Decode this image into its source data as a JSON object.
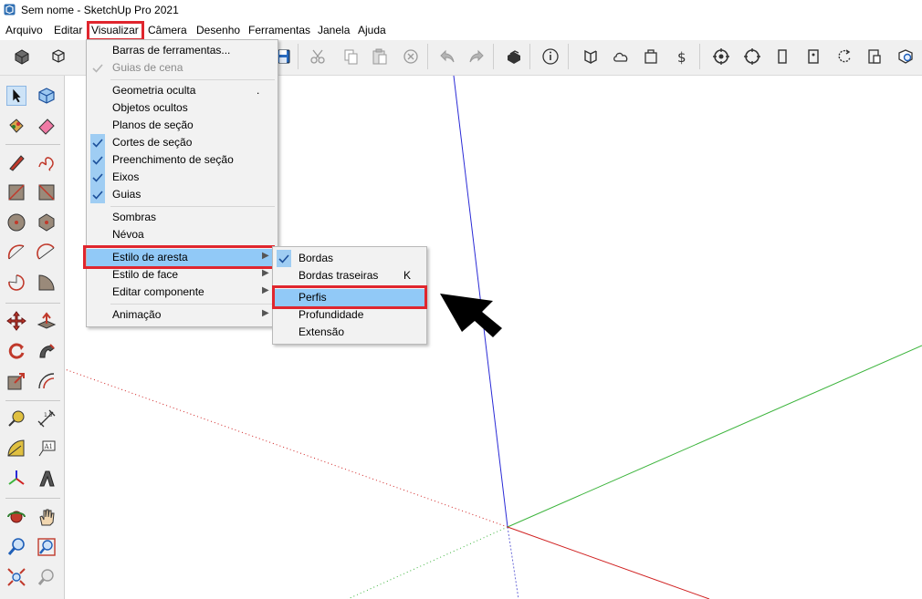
{
  "window": {
    "title": "Sem nome - SketchUp Pro 2021"
  },
  "menubar": {
    "items": [
      "Arquivo",
      "Editar",
      "Visualizar",
      "Câmera",
      "Desenho",
      "Ferramentas",
      "Janela",
      "Ajuda"
    ],
    "active": "Visualizar"
  },
  "view_menu": {
    "items": [
      {
        "label": "Barras de ferramentas..."
      },
      {
        "label": "Guias de cena",
        "disabled": true,
        "checked": true
      },
      {
        "label": "Geometria oculta",
        "shortcut": "."
      },
      {
        "label": "Objetos ocultos"
      },
      {
        "label": "Planos de seção"
      },
      {
        "label": "Cortes de seção",
        "checked": true
      },
      {
        "label": "Preenchimento de seção",
        "checked": true
      },
      {
        "label": "Eixos",
        "checked": true
      },
      {
        "label": "Guias",
        "checked": true
      },
      {
        "label": "Sombras"
      },
      {
        "label": "Névoa"
      },
      {
        "label": "Estilo de aresta",
        "submenu": true,
        "highlighted": true
      },
      {
        "label": "Estilo de face",
        "submenu": true
      },
      {
        "label": "Editar componente",
        "submenu": true
      },
      {
        "label": "Animação",
        "submenu": true
      }
    ]
  },
  "edge_style_submenu": {
    "items": [
      {
        "label": "Bordas",
        "checked": true
      },
      {
        "label": "Bordas traseiras",
        "shortcut": "K"
      },
      {
        "label": "Perfis",
        "highlighted": true
      },
      {
        "label": "Profundidade"
      },
      {
        "label": "Extensão"
      }
    ]
  },
  "colors": {
    "highlight_box": "#e0262e",
    "menu_hover": "#91c9f7",
    "axis_blue": "#2a2ad6",
    "axis_red": "#d02020",
    "axis_green": "#3cb43c"
  },
  "top_toolbar": {
    "icons": [
      "component-icon",
      "group-icon",
      "save-icon",
      "cut-icon",
      "copy-icon",
      "paste-icon",
      "erase-icon",
      "undo-icon",
      "redo-icon",
      "print-icon",
      "model-info-icon",
      "3d-warehouse-icon",
      "cloud-icon",
      "extension-warehouse-icon",
      "extension-manager-icon",
      "position-camera-icon",
      "look-around-icon",
      "walk-icon",
      "section-plane-icon",
      "orbit-icon",
      "layout-icon",
      "zoom-extents-icon"
    ]
  },
  "left_toolbar": {
    "icons": [
      "select-icon",
      "component-create-icon",
      "paint-bucket-icon",
      "eraser-icon",
      "pencil-icon",
      "freehand-icon",
      "rectangle-icon",
      "rotated-rectangle-icon",
      "circle-icon",
      "polygon-icon",
      "arc-icon",
      "two-point-arc-icon",
      "three-point-arc-icon",
      "pie-icon",
      "move-icon",
      "push-pull-icon",
      "rotate-icon",
      "follow-me-icon",
      "scale-icon",
      "offset-icon",
      "tape-measure-icon",
      "dimension-icon",
      "protractor-icon",
      "text-icon",
      "axes-icon",
      "3d-text-icon",
      "orbit-tool-icon",
      "pan-icon",
      "zoom-icon",
      "zoom-window-icon",
      "zoom-extents-tool-icon",
      "previous-view-icon"
    ]
  }
}
